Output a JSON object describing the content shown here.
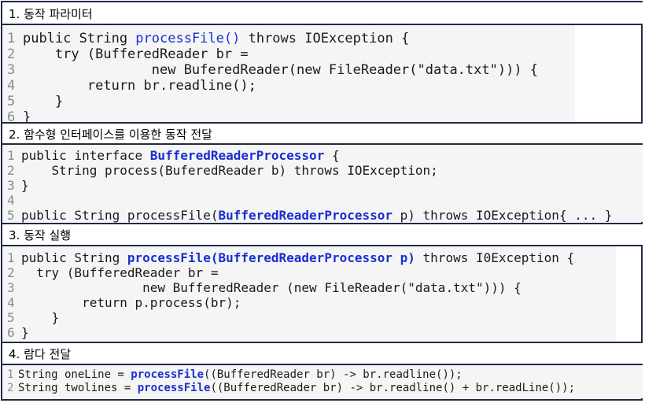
{
  "sections": [
    {
      "title": "1. 동작 파라미터",
      "lines": [
        {
          "n": "1",
          "a": "public String ",
          "h": "processFile()",
          "b": " throws IOException {"
        },
        {
          "n": "2",
          "a": "    try (BufferedReader br =",
          "h": "",
          "b": ""
        },
        {
          "n": "3",
          "a": "                new BuferedReader(new FileReader(\"data.txt\"))) {",
          "h": "",
          "b": ""
        },
        {
          "n": "4",
          "a": "        return br.readline();",
          "h": "",
          "b": ""
        },
        {
          "n": "5",
          "a": "    }",
          "h": "",
          "b": ""
        },
        {
          "n": "6",
          "a": "}",
          "h": "",
          "b": ""
        }
      ]
    },
    {
      "title": "2. 함수형 인터페이스를 이용한 동작 전달",
      "lines": [
        {
          "n": "1",
          "a": "public interface ",
          "h": "BufferedReaderProcessor",
          "b": " {"
        },
        {
          "n": "2",
          "a": "    String process(BuferedReader b) throws IOException;",
          "h": "",
          "b": ""
        },
        {
          "n": "3",
          "a": "}",
          "h": "",
          "b": ""
        },
        {
          "n": "4",
          "a": "",
          "h": "",
          "b": ""
        },
        {
          "n": "5",
          "a": "public String processFile(",
          "h": "BufferedReaderProcessor",
          "b": " p) throws IOException{ ... }"
        }
      ]
    },
    {
      "title": "3. 동작 실행",
      "lines": [
        {
          "n": "1",
          "a": "public String ",
          "h": "processFile(BufferedReaderProcessor p)",
          "b": " throws I0Exception {"
        },
        {
          "n": "2",
          "a": "  try (BufferedReader br =",
          "h": "",
          "b": ""
        },
        {
          "n": "3",
          "a": "                new BufferedReader (new FileReader(\"data.txt\"))) {",
          "h": "",
          "b": ""
        },
        {
          "n": "4",
          "a": "        return p.process(br);",
          "h": "",
          "b": ""
        },
        {
          "n": "5",
          "a": "    }",
          "h": "",
          "b": ""
        },
        {
          "n": "6",
          "a": "}",
          "h": "",
          "b": ""
        }
      ]
    },
    {
      "title": "4. 람다 전달",
      "lines": [
        {
          "n": "1",
          "a": "String oneLine = ",
          "h": "processFile",
          "b": "((BufferedReader br) -> br.readline());"
        },
        {
          "n": "2",
          "a": "String twolines = ",
          "h": "processFile",
          "b": "((BufferedReader br) -> br.readline() + br.readLine());"
        }
      ]
    }
  ]
}
